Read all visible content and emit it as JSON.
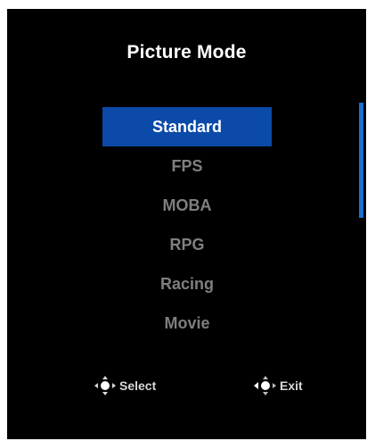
{
  "menu": {
    "title": "Picture Mode",
    "items": [
      {
        "label": "Standard",
        "selected": true
      },
      {
        "label": "FPS",
        "selected": false
      },
      {
        "label": "MOBA",
        "selected": false
      },
      {
        "label": "RPG",
        "selected": false
      },
      {
        "label": "Racing",
        "selected": false
      },
      {
        "label": "Movie",
        "selected": false
      }
    ]
  },
  "hints": {
    "select": {
      "icon": "joystick-icon",
      "label": "Select"
    },
    "exit": {
      "icon": "joystick-left-icon",
      "label": "Exit"
    }
  },
  "colors": {
    "background": "#000000",
    "highlight": "#0b4aa8",
    "scrollbar": "#1a6fd1",
    "inactive_text": "#7f7f7f",
    "active_text": "#ffffff"
  }
}
